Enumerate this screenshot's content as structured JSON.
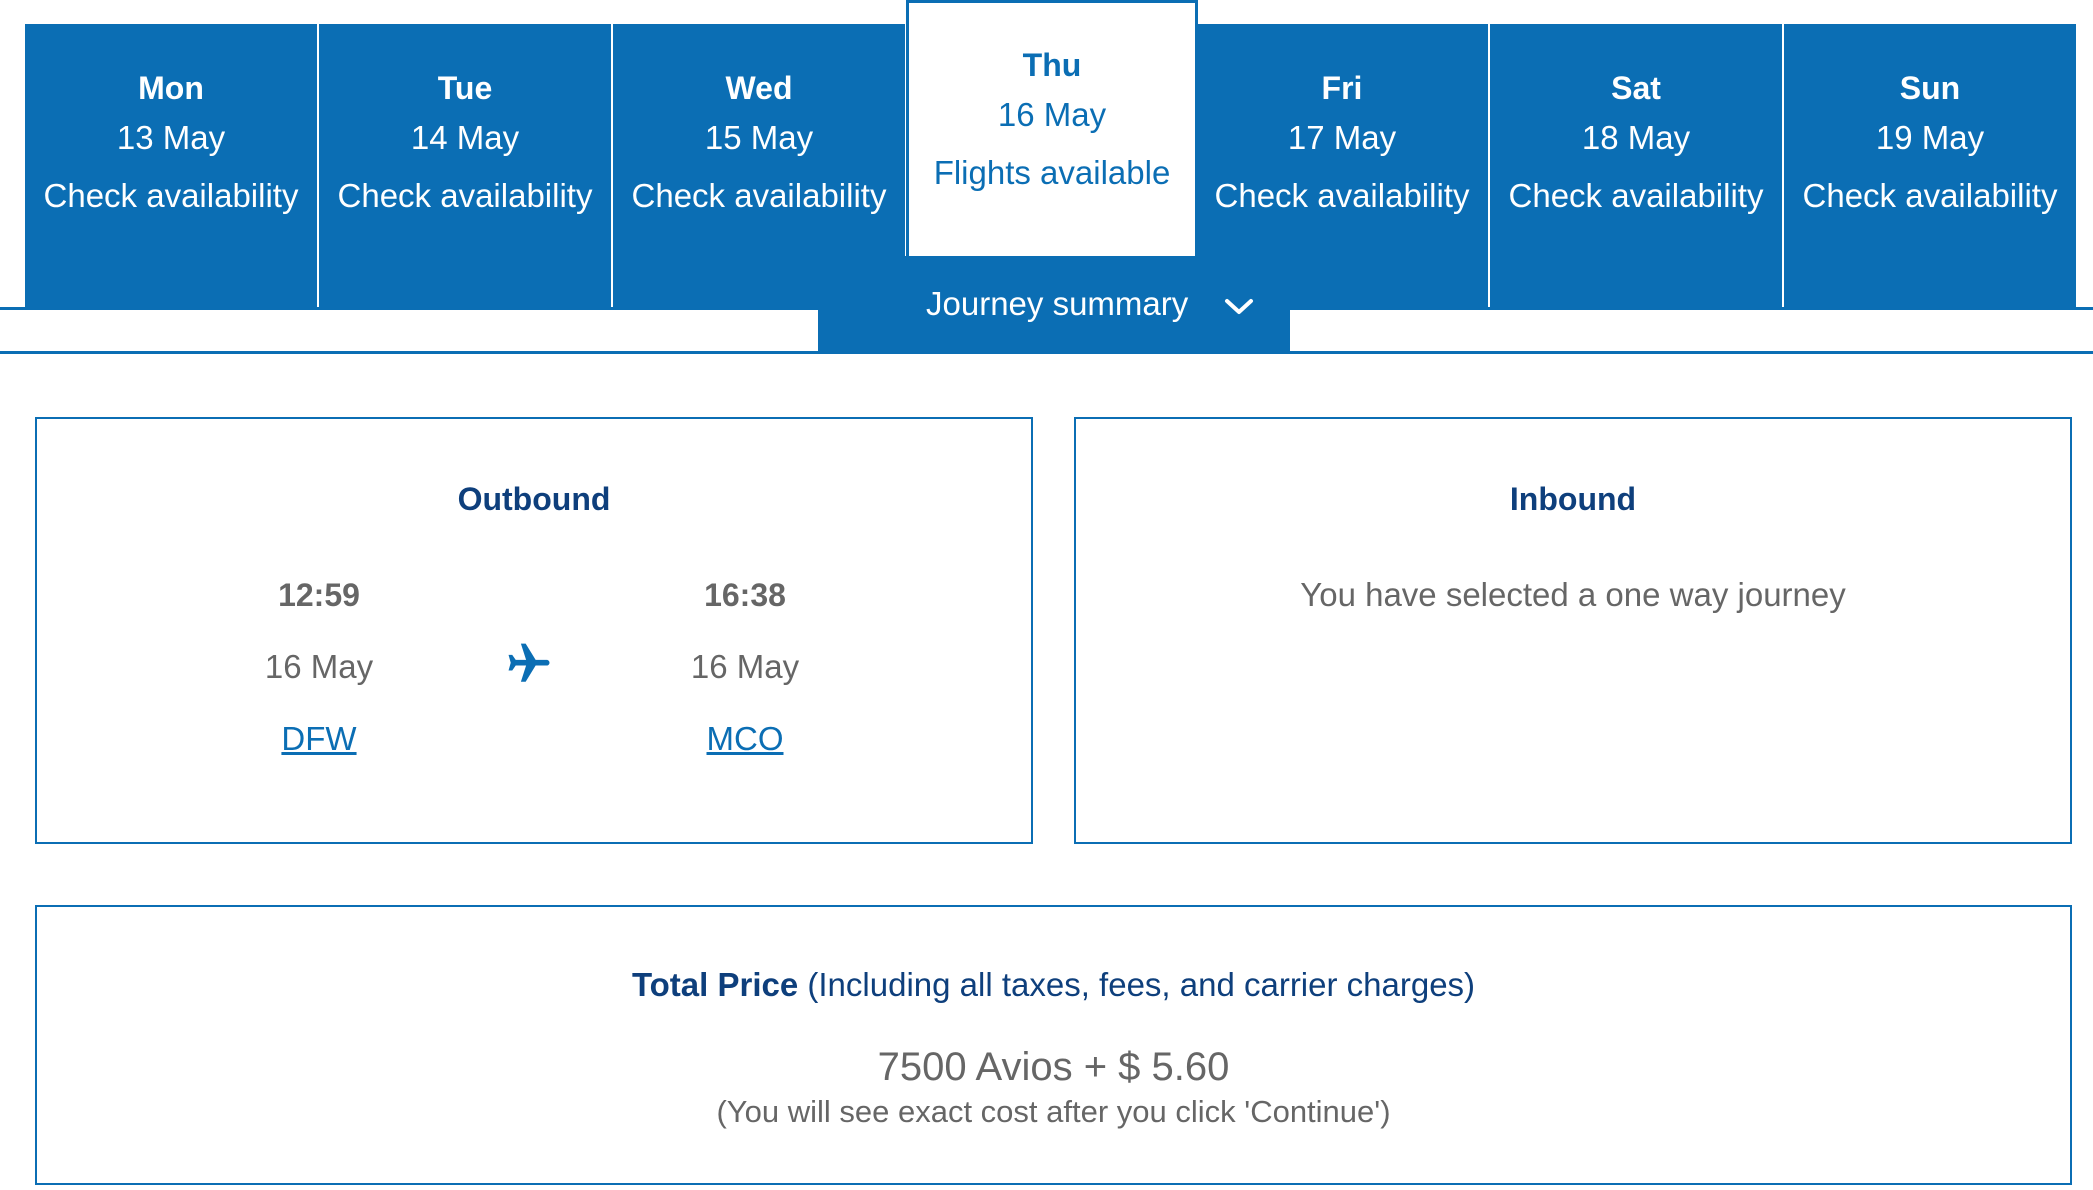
{
  "days": [
    {
      "name": "Mon",
      "date": "13 May",
      "status": "Check availability"
    },
    {
      "name": "Tue",
      "date": "14 May",
      "status": "Check availability"
    },
    {
      "name": "Wed",
      "date": "15 May",
      "status": "Check availability"
    },
    {
      "name": "Thu",
      "date": "16 May",
      "status": "Flights available"
    },
    {
      "name": "Fri",
      "date": "17 May",
      "status": "Check availability"
    },
    {
      "name": "Sat",
      "date": "18 May",
      "status": "Check availability"
    },
    {
      "name": "Sun",
      "date": "19 May",
      "status": "Check availability"
    }
  ],
  "selected_day": "Thu",
  "summary_toggle": {
    "label": "Journey summary",
    "icon": "chevron-down-icon"
  },
  "outbound": {
    "title": "Outbound",
    "departure": {
      "time": "12:59",
      "date": "16 May",
      "airport": "DFW"
    },
    "arrival": {
      "time": "16:38",
      "date": "16 May",
      "airport": "MCO"
    },
    "icon": "plane-icon"
  },
  "inbound": {
    "title": "Inbound",
    "message": "You have selected a one way journey"
  },
  "price": {
    "title": "Total Price",
    "note_inline": "(Including all taxes, fees, and carrier charges)",
    "amount": "7500 Avios + $ 5.60",
    "note": "(You will see exact cost after you click 'Continue')"
  },
  "colors": {
    "accent": "#0b6eb4",
    "heading": "#0e3f7c",
    "text": "#666666"
  }
}
